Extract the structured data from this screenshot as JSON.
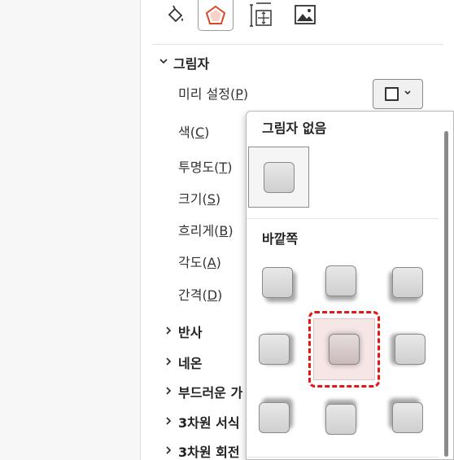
{
  "tabs": [
    {
      "name": "fill-line",
      "icon": "paint-bucket-icon",
      "active": false
    },
    {
      "name": "effects",
      "icon": "pentagon-icon",
      "active": true
    },
    {
      "name": "size-properties",
      "icon": "size-position-icon",
      "active": false
    },
    {
      "name": "picture",
      "icon": "picture-icon",
      "active": false
    }
  ],
  "shadow_section": {
    "title": "그림자",
    "preset": {
      "label": "미리 설정",
      "key": "P"
    },
    "color": {
      "label": "색",
      "key": "C"
    },
    "transparency": {
      "label": "투명도",
      "key": "T"
    },
    "size": {
      "label": "크기",
      "key": "S"
    },
    "blur": {
      "label": "흐리게",
      "key": "B"
    },
    "angle": {
      "label": "각도",
      "key": "A"
    },
    "distance": {
      "label": "간격",
      "key": "D"
    }
  },
  "collapsed_sections": [
    "반사",
    "네온",
    "부드러운 가",
    "3차원 서식",
    "3차원 회전"
  ],
  "popup": {
    "no_shadow_title": "그림자 없음",
    "outer_title": "바깥쪽",
    "selected_preset": "outer-center"
  },
  "colors": {
    "selection_dash": "#e01818",
    "selection_fill": "#f6e6e6"
  }
}
